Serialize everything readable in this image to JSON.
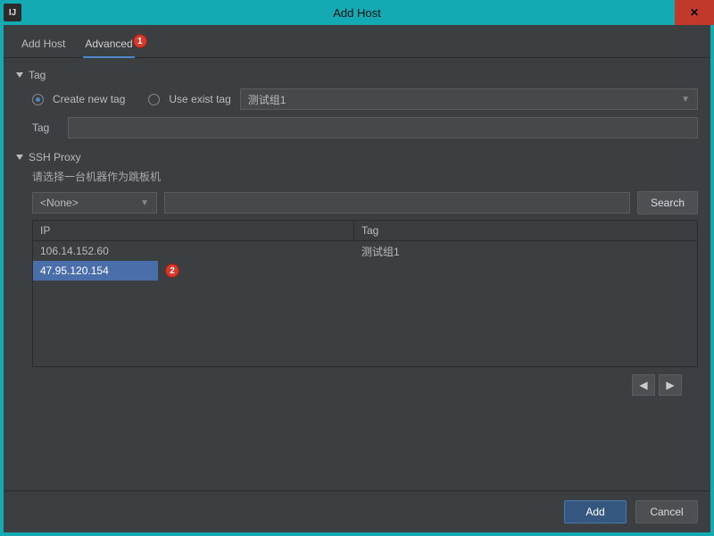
{
  "window": {
    "title": "Add Host",
    "app_icon_text": "IJ"
  },
  "tabs": {
    "add_host": "Add Host",
    "advanced": "Advanced",
    "active": "advanced"
  },
  "callouts": {
    "tab_badge": "1",
    "row_badge": "2"
  },
  "tag_section": {
    "title": "Tag",
    "create_label": "Create new tag",
    "use_exist_label": "Use exist tag",
    "selected_mode": "create",
    "tag_combo_value": "测试组1",
    "tag_field_label": "Tag",
    "tag_field_value": ""
  },
  "ssh_section": {
    "title": "SSH Proxy",
    "hint": "请选择一台机器作为跳板机",
    "selector_value": "<None>",
    "search_value": "",
    "search_button": "Search"
  },
  "table": {
    "headers": {
      "ip": "IP",
      "tag": "Tag"
    },
    "rows": [
      {
        "ip": "106.14.152.60",
        "tag": "测试组1",
        "selected": false
      },
      {
        "ip": "47.95.120.154",
        "tag": "",
        "selected": true
      }
    ]
  },
  "footer": {
    "add": "Add",
    "cancel": "Cancel"
  }
}
